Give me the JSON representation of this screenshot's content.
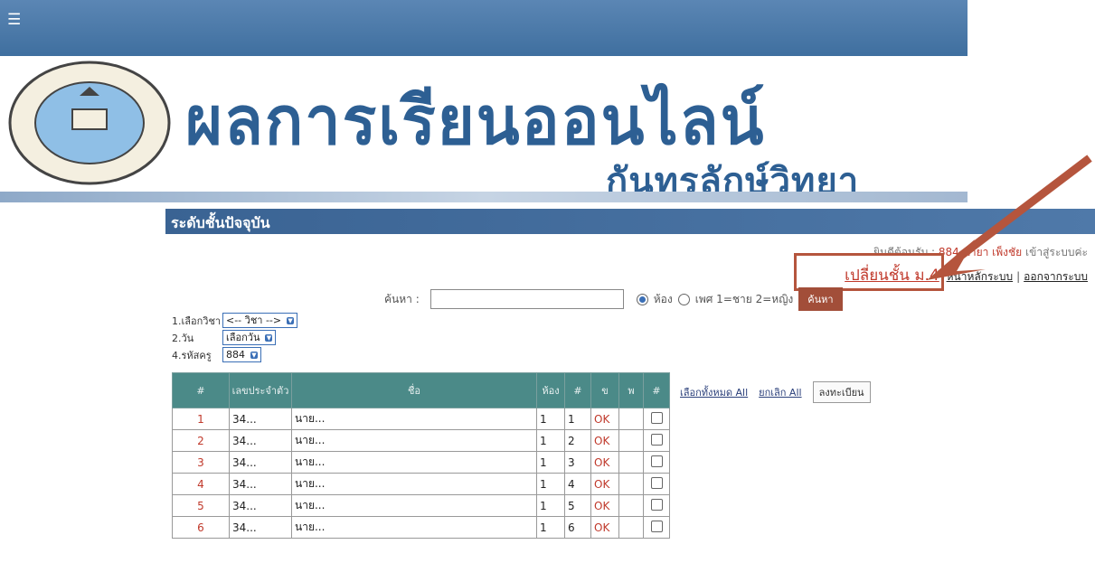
{
  "header": {
    "menu_icon": "hamburger-icon",
    "title": "ผลการเรียนออนไลน์",
    "school": "กันทรลักษ์วิทยา"
  },
  "section": {
    "title": "ระดับชั้นปัจจุบัน"
  },
  "user": {
    "welcome_label": "ยินดีต้อนรับ :",
    "id": "884",
    "name": "นายา เพ็งชัย",
    "suffix": "เข้าสู่ระบบค่ะ"
  },
  "links": {
    "change_class": "เปลี่ยนชั้น ม.4",
    "home": "หน้าหลักระบบ",
    "logout": "ออกจากระบบ"
  },
  "search": {
    "label": "ค้นหา :",
    "value": "",
    "radio1": "ห้อง",
    "radio2": "เพศ 1=ชาย 2=หญิง",
    "button": "ค้นหา"
  },
  "filters": {
    "subject_label": "1.เลือกวิชา",
    "subject_value": "<-- วิชา -->",
    "day_label": "2.วัน",
    "day_value": "เลือกวัน",
    "code_label": "4.รหัสครู",
    "code_value": "884"
  },
  "table": {
    "headers": [
      "#",
      "เลขประจำตัว",
      "ชื่อ",
      "ห้อง",
      "#",
      "ข",
      "พ",
      "#"
    ],
    "rows": [
      {
        "n": "1",
        "id": "34...",
        "name": "นาย...",
        "room": "1",
        "no": "1",
        "s": "OK"
      },
      {
        "n": "2",
        "id": "34...",
        "name": "นาย...",
        "room": "1",
        "no": "2",
        "s": "OK"
      },
      {
        "n": "3",
        "id": "34...",
        "name": "นาย...",
        "room": "1",
        "no": "3",
        "s": "OK"
      },
      {
        "n": "4",
        "id": "34...",
        "name": "นาย...",
        "room": "1",
        "no": "4",
        "s": "OK"
      },
      {
        "n": "5",
        "id": "34...",
        "name": "นาย...",
        "room": "1",
        "no": "5",
        "s": "OK"
      },
      {
        "n": "6",
        "id": "34...",
        "name": "นาย...",
        "room": "1",
        "no": "6",
        "s": "OK"
      }
    ]
  },
  "bulk": {
    "select_all": "เลือกทั้งหมด All",
    "cancel_all": "ยกเลิก All",
    "register": "ลงทะเบียน"
  }
}
